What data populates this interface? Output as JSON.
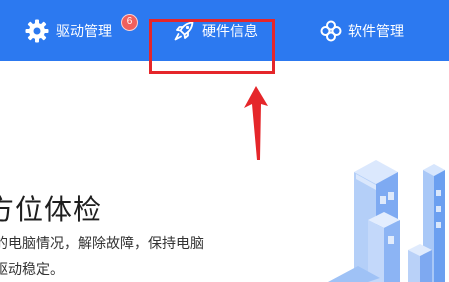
{
  "nav": {
    "drivers": {
      "label": "驱动管理",
      "icon": "gear-icon",
      "badge": "6"
    },
    "hardware": {
      "label": "硬件信息",
      "icon": "rocket-icon"
    },
    "software": {
      "label": "软件管理",
      "icon": "flower-icon"
    }
  },
  "main": {
    "headline": "方位体检",
    "description_lines": [
      "的电脑情况，解除故障，保持电脑",
      "驱动稳定。"
    ]
  },
  "colors": {
    "topbar": "#2c79f0",
    "highlight": "#e5262a",
    "badge": "#f0605d"
  }
}
